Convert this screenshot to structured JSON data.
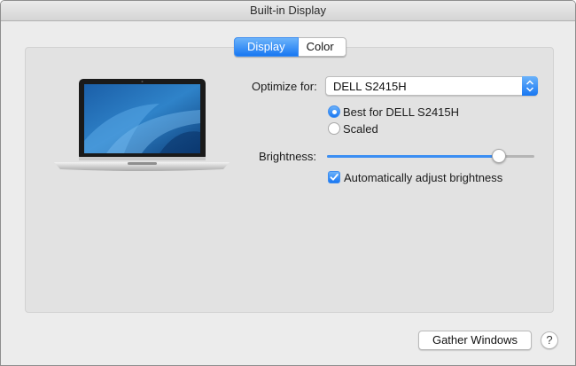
{
  "window": {
    "title": "Built-in Display"
  },
  "tabs": [
    {
      "label": "Display",
      "selected": true
    },
    {
      "label": "Color",
      "selected": false
    }
  ],
  "display": {
    "optimize_label": "Optimize for:",
    "optimize_value": "DELL S2415H",
    "resolution_options": [
      {
        "label": "Best for DELL S2415H",
        "selected": true
      },
      {
        "label": "Scaled",
        "selected": false
      }
    ],
    "brightness_label": "Brightness:",
    "brightness_level": 0.83,
    "auto_brightness_label": "Automatically adjust brightness",
    "auto_brightness_checked": true
  },
  "footer": {
    "gather_button": "Gather Windows",
    "help_icon": "?"
  },
  "icons": {
    "device": "laptop-icon",
    "popup": "chevron-up-down-icon",
    "check": "checkmark-icon"
  },
  "colors": {
    "accent": "#1877f2",
    "window_bg": "#ececec",
    "panel_bg": "#e2e2e2"
  }
}
